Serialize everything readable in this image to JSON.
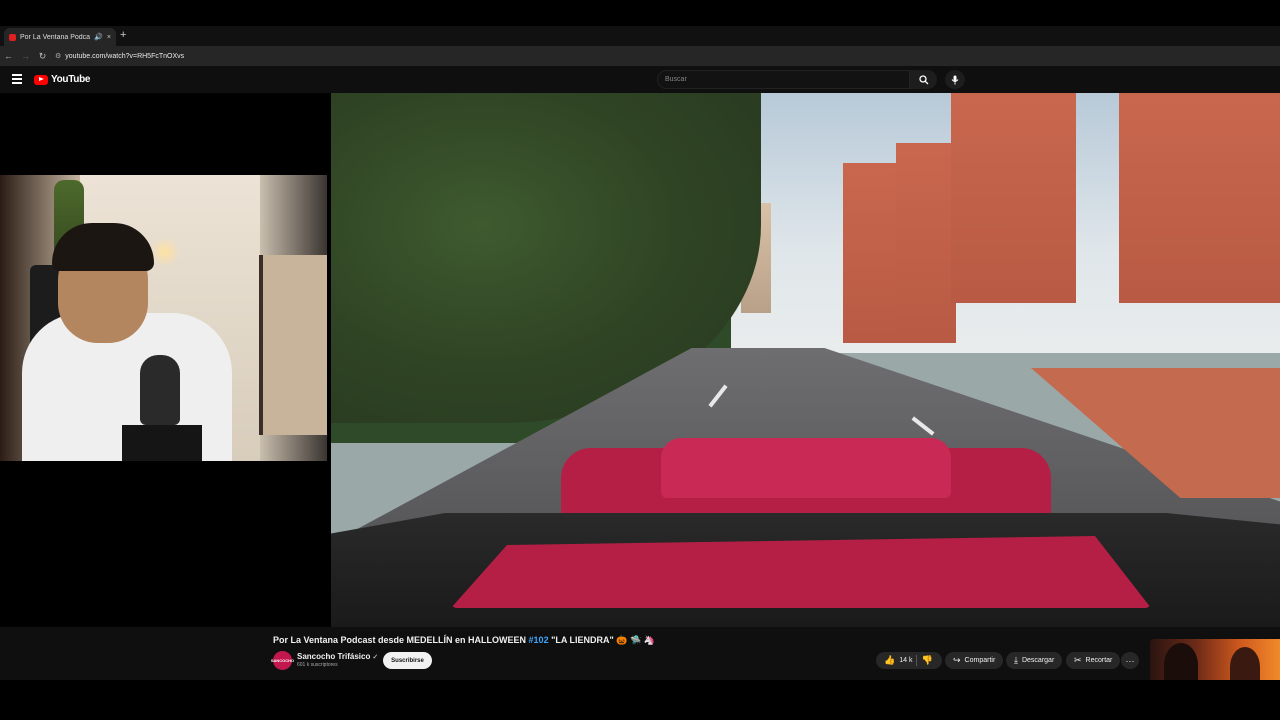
{
  "browser": {
    "tab_title": "Por La Ventana Podcast de...",
    "tab_audio": "🔊",
    "tab_close": "×",
    "new_tab": "+",
    "url": "youtube.com/watch?v=RH5FcTnOXvs"
  },
  "youtube": {
    "logo_text": "YouTube",
    "search_placeholder": "Buscar"
  },
  "video": {
    "title_prefix": "Por La Ventana Podcast desde MEDELLÍN en HALLOWEEN ",
    "title_hashtag": "#102",
    "title_suffix": " \"LA LIENDRA\" 🎃 🛸 🦄",
    "channel_name": "Sancocho Trifásico",
    "channel_avatar_text": "SANCOCHO",
    "channel_verified": "✓",
    "subscribers": "601 k suscriptores",
    "subscribe_label": "Suscribirse",
    "likes": "14 k",
    "share_label": "Compartir",
    "download_label": "Descargar",
    "clip_label": "Recortar",
    "more_label": "···"
  },
  "icons": {
    "like": "thumbs-up-icon",
    "dislike": "thumbs-down-icon",
    "share": "share-icon",
    "download": "download-icon",
    "clip": "scissors-icon",
    "search": "search-icon",
    "mic": "mic-icon"
  },
  "colors": {
    "brand_red": "#ff0000",
    "background": "#0f0f0f",
    "hashtag": "#3ea6ff"
  }
}
